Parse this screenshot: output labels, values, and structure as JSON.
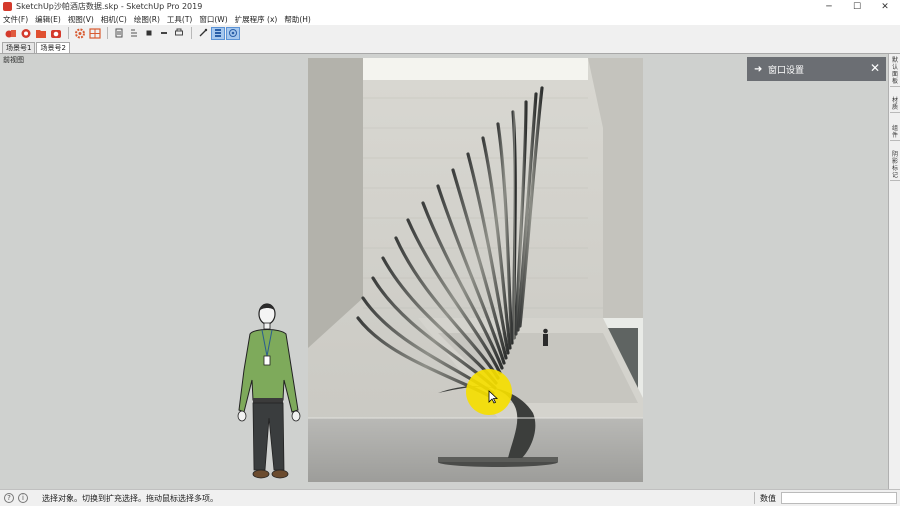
{
  "window": {
    "title": "SketchUp沙帕酒店数据.skp - SketchUp Pro 2019",
    "minimize": "─",
    "maximize": "☐",
    "close": "✕"
  },
  "menu": {
    "items": [
      {
        "label": "文件(F)"
      },
      {
        "label": "编辑(E)"
      },
      {
        "label": "视图(V)"
      },
      {
        "label": "相机(C)"
      },
      {
        "label": "绘图(R)"
      },
      {
        "label": "工具(T)"
      },
      {
        "label": "窗口(W)"
      },
      {
        "label": "扩展程序 (x)"
      },
      {
        "label": "帮助(H)"
      }
    ]
  },
  "toolbar": {
    "icons": [
      "extension-warehouse-icon",
      "extension-manager-icon",
      "open-folder-icon",
      "camera-icon",
      "settings-gear-icon",
      "style-builder-icon",
      "pages-icon",
      "sections-icon",
      "component-icon",
      "sandbox-icon",
      "print-icon",
      "solar-icon",
      "layout-icon",
      "shadow-icon"
    ]
  },
  "scenes": {
    "tabs": [
      {
        "label": "场景号1",
        "active": false
      },
      {
        "label": "场景号2",
        "active": true
      }
    ]
  },
  "viewport": {
    "view_label": "前视图"
  },
  "tray": {
    "title": "窗口设置",
    "side_tabs": [
      {
        "label": "默认面板"
      },
      {
        "label": "材质"
      },
      {
        "label": "组件"
      },
      {
        "label": "阴影标记"
      }
    ]
  },
  "status": {
    "text": "选择对象。切换到扩充选择。拖动鼠标选择多项。",
    "measure_label": "数值",
    "measure_value": ""
  },
  "colors": {
    "tray_header": "#6b6e73",
    "cursor_highlight": "#f5de00",
    "sketchup_red": "#d43a2c"
  }
}
